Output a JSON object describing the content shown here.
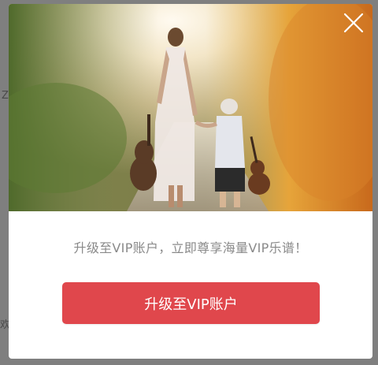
{
  "background_page": {
    "glyph_top": "Z",
    "glyph_bottom": "欢"
  },
  "modal": {
    "hero_image": "mother-and-child-walking-with-guitars",
    "close_icon": "close-icon",
    "tagline": "升级至VIP账户，立即尊享海量VIP乐谱！",
    "cta_label": "升级至VIP账户"
  },
  "colors": {
    "overlay": "#7f7f7f",
    "cta_background": "#e0474c",
    "tagline_text": "#8a8a8a"
  }
}
